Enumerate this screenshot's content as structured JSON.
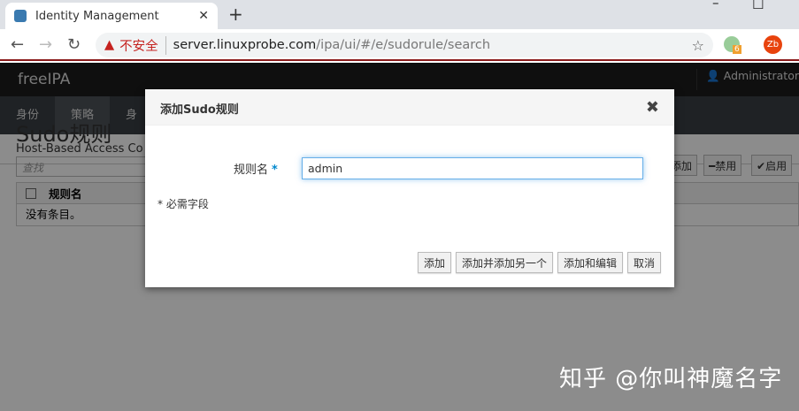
{
  "browser": {
    "tab_title": "Identity Management",
    "tab_close": "✕",
    "new_tab": "+",
    "min": "–",
    "max": "☐",
    "insecure_label": "不安全",
    "url_host": "server.linuxprobe.com",
    "url_path": "/ipa/ui/#/e/sudorule/search",
    "ext_badge": "6",
    "profile": "Zb"
  },
  "app": {
    "brand": "freeIPA",
    "user": "Administrator",
    "menu": [
      "身份",
      "策略",
      "身"
    ],
    "subnav": "Host-Based Access Co",
    "page_title": "Sudo规则",
    "search_placeholder": "查找",
    "toolbar": {
      "add": "添加",
      "disable": "禁用",
      "enable": "启用"
    },
    "table": {
      "column": "规则名",
      "empty": "没有条目。"
    }
  },
  "modal": {
    "title": "添加Sudo规则",
    "close": "✖",
    "field_label": "规则名",
    "required_mark": "*",
    "field_value": "admin",
    "required_note": "* 必需字段",
    "buttons": {
      "add": "添加",
      "add_another": "添加并添加另一个",
      "add_edit": "添加和编辑",
      "cancel": "取消"
    }
  },
  "watermark": "知乎 @你叫神魔名字"
}
